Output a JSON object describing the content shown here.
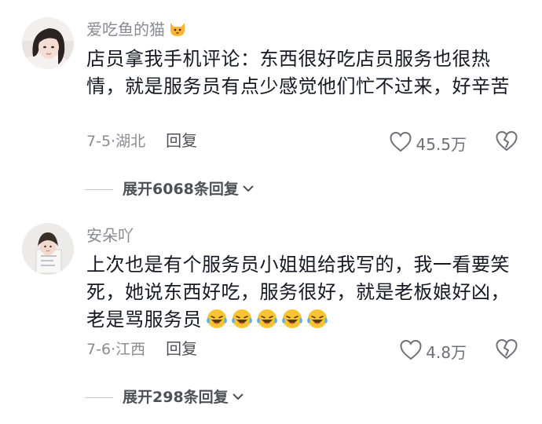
{
  "comments": [
    {
      "username": "爱吃鱼的猫",
      "username_emoji": "cat-face-icon",
      "text": "店员拿我手机评论：东西很好吃店员服务也很热情，就是服务员有点少感觉他们忙不过来，好辛苦",
      "date_location": "7-5·湖北",
      "reply_label": "回复",
      "likes": "45.5万",
      "expand_label": "展开6068条回复"
    },
    {
      "username": "安朵吖",
      "text": "上次也是有个服务员小姐姐给我写的，我一看要笑死，她说东西好吃，服务很好，就是老板娘好凶，老是骂服务员",
      "trailing_emojis": [
        "crying-laughing-icon",
        "crying-laughing-icon",
        "crying-laughing-icon",
        "crying-laughing-icon",
        "crying-laughing-icon"
      ],
      "date_location": "7-6·江西",
      "reply_label": "回复",
      "likes": "4.8万",
      "expand_label": "展开298条回复"
    }
  ]
}
